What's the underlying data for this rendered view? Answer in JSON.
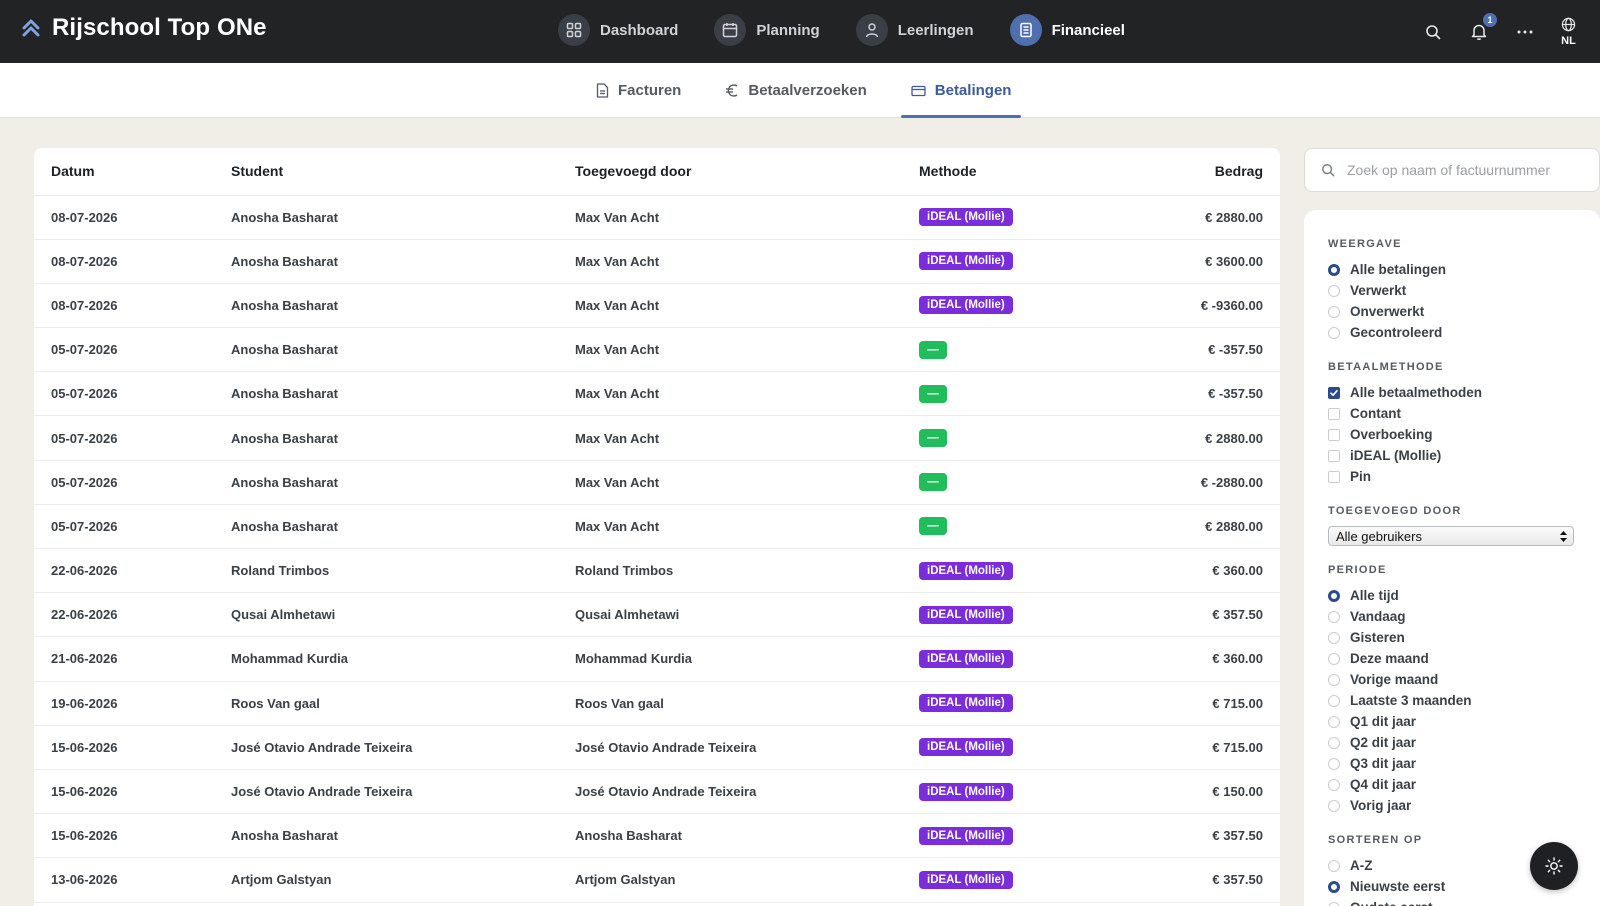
{
  "app": {
    "title": "Rijschool Top ONe"
  },
  "nav": [
    {
      "label": "Dashboard",
      "icon": "dashboard-grid-icon"
    },
    {
      "label": "Planning",
      "icon": "calendar-icon"
    },
    {
      "label": "Leerlingen",
      "icon": "user-icon"
    },
    {
      "label": "Financieel",
      "icon": "document-icon",
      "active": true
    }
  ],
  "topbar": {
    "notifications_count": "1",
    "language": "NL"
  },
  "subtabs": [
    {
      "label": "Facturen",
      "icon": "file-icon"
    },
    {
      "label": "Betaalverzoeken",
      "icon": "euro-icon"
    },
    {
      "label": "Betalingen",
      "icon": "card-icon",
      "active": true
    }
  ],
  "table": {
    "headers": {
      "date": "Datum",
      "student": "Student",
      "added_by": "Toegevoegd door",
      "method": "Methode",
      "amount": "Bedrag"
    },
    "rows": [
      {
        "date": "08-07-2026",
        "student": "Anosha Basharat",
        "added_by": "Max Van Acht",
        "method": "iDEAL (Mollie)",
        "method_color": "#7b2ddb",
        "amount": "€ 2880.00"
      },
      {
        "date": "08-07-2026",
        "student": "Anosha Basharat",
        "added_by": "Max Van Acht",
        "method": "iDEAL (Mollie)",
        "method_color": "#7b2ddb",
        "amount": "€ 3600.00"
      },
      {
        "date": "08-07-2026",
        "student": "Anosha Basharat",
        "added_by": "Max Van Acht",
        "method": "iDEAL (Mollie)",
        "method_color": "#7b2ddb",
        "amount": "€ -9360.00"
      },
      {
        "date": "05-07-2026",
        "student": "Anosha Basharat",
        "added_by": "Max Van Acht",
        "method": "—",
        "method_color": "#22bd5b",
        "amount": "€ -357.50"
      },
      {
        "date": "05-07-2026",
        "student": "Anosha Basharat",
        "added_by": "Max Van Acht",
        "method": "—",
        "method_color": "#22bd5b",
        "amount": "€ -357.50"
      },
      {
        "date": "05-07-2026",
        "student": "Anosha Basharat",
        "added_by": "Max Van Acht",
        "method": "—",
        "method_color": "#22bd5b",
        "amount": "€ 2880.00"
      },
      {
        "date": "05-07-2026",
        "student": "Anosha Basharat",
        "added_by": "Max Van Acht",
        "method": "—",
        "method_color": "#22bd5b",
        "amount": "€ -2880.00"
      },
      {
        "date": "05-07-2026",
        "student": "Anosha Basharat",
        "added_by": "Max Van Acht",
        "method": "—",
        "method_color": "#22bd5b",
        "amount": "€ 2880.00"
      },
      {
        "date": "22-06-2026",
        "student": "Roland Trimbos",
        "added_by": "Roland Trimbos",
        "method": "iDEAL (Mollie)",
        "method_color": "#7b2ddb",
        "amount": "€ 360.00"
      },
      {
        "date": "22-06-2026",
        "student": "Qusai Almhetawi",
        "added_by": "Qusai Almhetawi",
        "method": "iDEAL (Mollie)",
        "method_color": "#7b2ddb",
        "amount": "€ 357.50"
      },
      {
        "date": "21-06-2026",
        "student": "Mohammad Kurdia",
        "added_by": "Mohammad Kurdia",
        "method": "iDEAL (Mollie)",
        "method_color": "#7b2ddb",
        "amount": "€ 360.00"
      },
      {
        "date": "19-06-2026",
        "student": "Roos Van gaal",
        "added_by": "Roos Van gaal",
        "method": "iDEAL (Mollie)",
        "method_color": "#7b2ddb",
        "amount": "€ 715.00"
      },
      {
        "date": "15-06-2026",
        "student": "José Otavio Andrade Teixeira",
        "added_by": "José Otavio Andrade Teixeira",
        "method": "iDEAL (Mollie)",
        "method_color": "#7b2ddb",
        "amount": "€ 715.00"
      },
      {
        "date": "15-06-2026",
        "student": "José Otavio Andrade Teixeira",
        "added_by": "José Otavio Andrade Teixeira",
        "method": "iDEAL (Mollie)",
        "method_color": "#7b2ddb",
        "amount": "€ 150.00"
      },
      {
        "date": "15-06-2026",
        "student": "Anosha Basharat",
        "added_by": "Anosha Basharat",
        "method": "iDEAL (Mollie)",
        "method_color": "#7b2ddb",
        "amount": "€ 357.50"
      },
      {
        "date": "13-06-2026",
        "student": "Artjom Galstyan",
        "added_by": "Artjom Galstyan",
        "method": "iDEAL (Mollie)",
        "method_color": "#7b2ddb",
        "amount": "€ 357.50"
      }
    ]
  },
  "search": {
    "placeholder": "Zoek op naam of factuurnummer",
    "value": ""
  },
  "filters": {
    "weergave": {
      "label": "WEERGAVE",
      "options": [
        "Alle betalingen",
        "Verwerkt",
        "Onverwerkt",
        "Gecontroleerd"
      ],
      "selected": "Alle betalingen"
    },
    "betaalmethode": {
      "label": "BETAALMETHODE",
      "options": [
        "Alle betaalmethoden",
        "Contant",
        "Overboeking",
        "iDEAL (Mollie)",
        "Pin"
      ],
      "checked": [
        "Alle betaalmethoden"
      ]
    },
    "toegevoegd_door": {
      "label": "TOEGEVOEGD DOOR",
      "value": "Alle gebruikers"
    },
    "periode": {
      "label": "PERIODE",
      "options": [
        "Alle tijd",
        "Vandaag",
        "Gisteren",
        "Deze maand",
        "Vorige maand",
        "Laatste 3 maanden",
        "Q1 dit jaar",
        "Q2 dit jaar",
        "Q3 dit jaar",
        "Q4 dit jaar",
        "Vorig jaar"
      ],
      "selected": "Alle tijd"
    },
    "sorteren_op": {
      "label": "SORTEREN OP",
      "options": [
        "A-Z",
        "Nieuwste eerst",
        "Oudste eerst"
      ],
      "selected": "Nieuwste eerst"
    }
  },
  "colors": {
    "topbar": "#222324",
    "accent": "#4f6fb0",
    "ideal": "#7b2ddb",
    "green": "#22bd5b",
    "background": "#f1eee7"
  }
}
